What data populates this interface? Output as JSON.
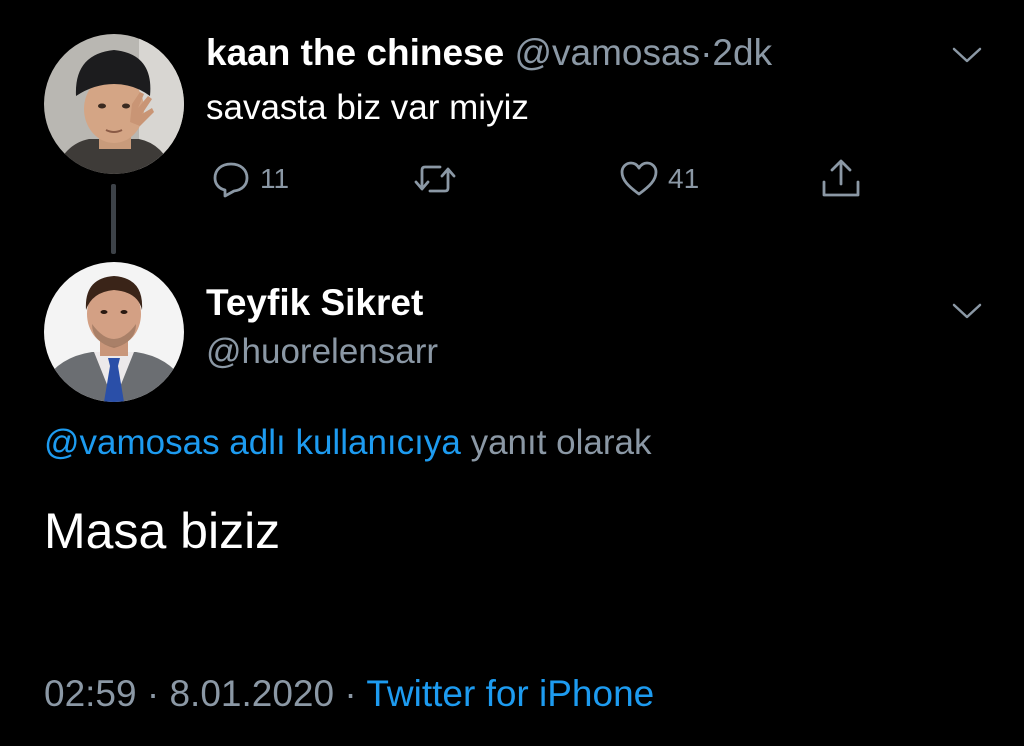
{
  "tweet": {
    "name": "kaan the chinese",
    "handle": "@vamosas",
    "separator": "·",
    "time": "2dk",
    "text": "savasta biz var miyiz",
    "actions": {
      "reply_icon": "reply-icon",
      "reply_count": "11",
      "retweet_icon": "retweet-icon",
      "like_icon": "heart-icon",
      "like_count": "41",
      "share_icon": "share-icon"
    },
    "menu_icon": "chevron-down-icon"
  },
  "reply": {
    "name": "Teyfik Sikret",
    "handle": "@huorelensarr",
    "replying_to_mention": "@vamosas adlı kullanıcıya",
    "replying_to_suffix": "yanıt olarak",
    "text": "Masa biziz",
    "time": "02:59",
    "separator": "·",
    "date": "8.01.2020",
    "source": "Twitter for iPhone",
    "menu_icon": "chevron-down-icon"
  },
  "colors": {
    "background": "#000000",
    "text_primary": "#ffffff",
    "text_secondary": "#8b98a5",
    "link": "#1d9bf0"
  }
}
